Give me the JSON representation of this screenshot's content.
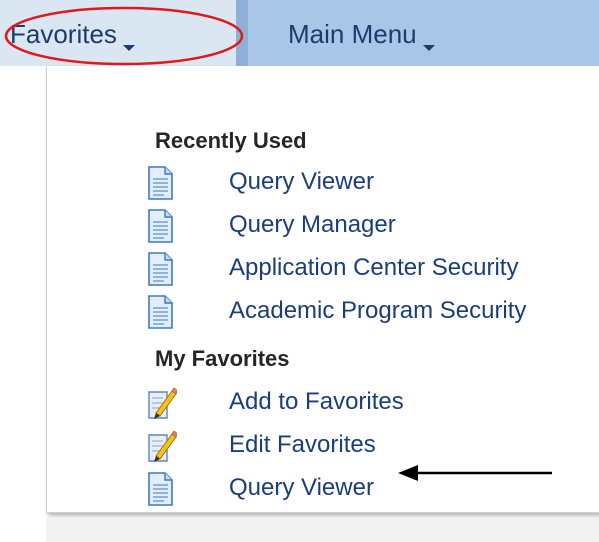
{
  "menubar": {
    "favorites_label": "Favorites",
    "main_menu_label": "Main Menu"
  },
  "dropdown": {
    "recently_used": {
      "header": "Recently Used",
      "items": [
        {
          "label": "Query Viewer",
          "icon": "document-icon"
        },
        {
          "label": "Query Manager",
          "icon": "document-icon"
        },
        {
          "label": "Application Center Security",
          "icon": "document-icon"
        },
        {
          "label": "Academic Program Security",
          "icon": "document-icon"
        }
      ]
    },
    "my_favorites": {
      "header": "My Favorites",
      "items": [
        {
          "label": "Add to Favorites",
          "icon": "edit-pencil-icon"
        },
        {
          "label": "Edit Favorites",
          "icon": "edit-pencil-icon"
        },
        {
          "label": "Query Viewer",
          "icon": "document-icon"
        }
      ]
    }
  },
  "colors": {
    "menubar_bg": "#b8cde6",
    "favorites_tab_bg": "#dbe6f3",
    "link_text": "#1a3e7a",
    "highlight_circle": "#e01818",
    "annotation_arrow": "#000000"
  }
}
